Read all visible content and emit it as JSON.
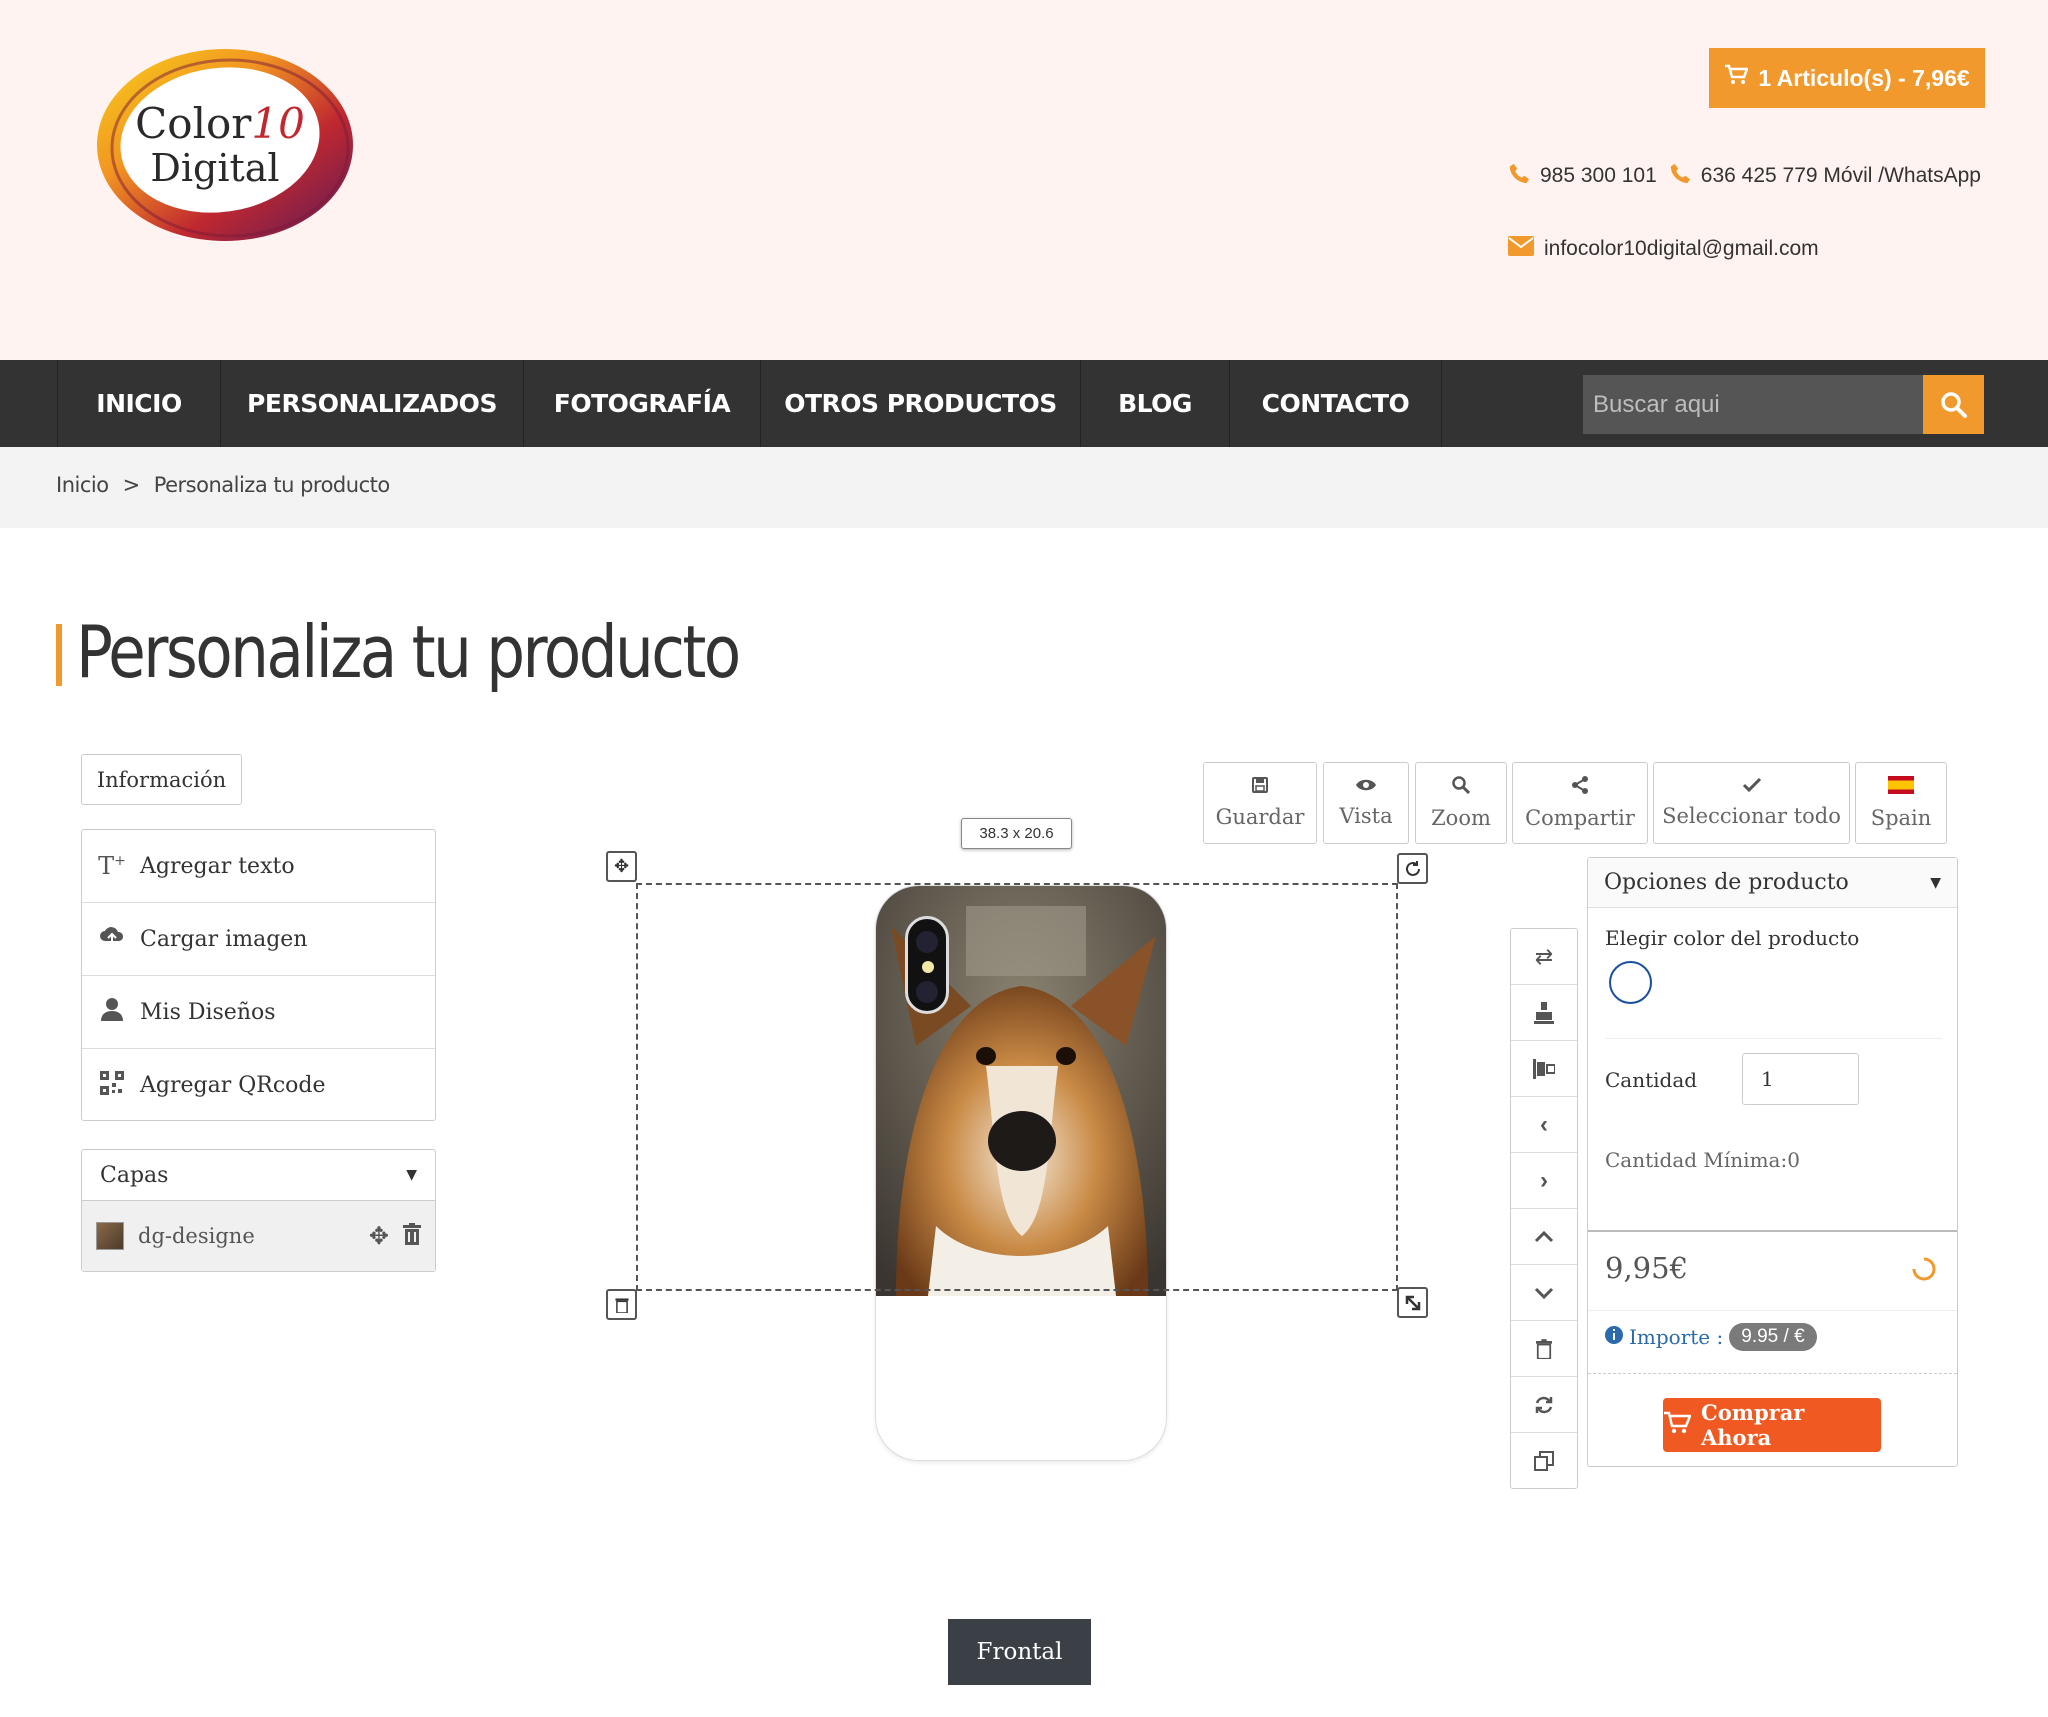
{
  "header": {
    "logo_line1": "Color",
    "logo_ten": "10",
    "logo_line2": "Digital",
    "cart": "1 Articulo(s) - 7,96€",
    "phone1": "985 300 101",
    "phone2": "636 425 779 Móvil /WhatsApp",
    "email": "infocolor10digital@gmail.com"
  },
  "nav": {
    "items": [
      "INICIO",
      "PERSONALIZADOS",
      "FOTOGRAFÍA",
      "OTROS PRODUCTOS",
      "BLOG",
      "CONTACTO"
    ],
    "search_placeholder": "Buscar aqui"
  },
  "breadcrumb": {
    "home": "Inicio",
    "separator": ">",
    "current": "Personaliza tu producto"
  },
  "page": {
    "title": "Personaliza tu producto"
  },
  "left_panel": {
    "info_button": "Información",
    "tools": [
      "Agregar texto",
      "Cargar imagen",
      "Mis Diseños",
      "Agregar QRcode"
    ],
    "layers_title": "Capas",
    "layer_name": "dg-designe"
  },
  "canvas": {
    "dimensions": "38.3 x 20.6",
    "view_button": "Frontal"
  },
  "toolbar": {
    "save": "Guardar",
    "view": "Vista",
    "zoom": "Zoom",
    "share": "Compartir",
    "select_all": "Seleccionar todo",
    "language": "Spain"
  },
  "options": {
    "title": "Opciones de producto",
    "color_label": "Elegir color del producto",
    "quantity_label": "Cantidad",
    "quantity_value": "1",
    "min_quantity": "Cantidad Mínima:0",
    "price": "9,95€",
    "importe_label": "Importe :",
    "importe_value": "9.95 / €",
    "buy_button": "Comprar Ahora"
  },
  "colors": {
    "accent": "#f2992e",
    "nav_bg": "#333333",
    "buy": "#f05a22",
    "header_bg": "#fef3f0"
  }
}
